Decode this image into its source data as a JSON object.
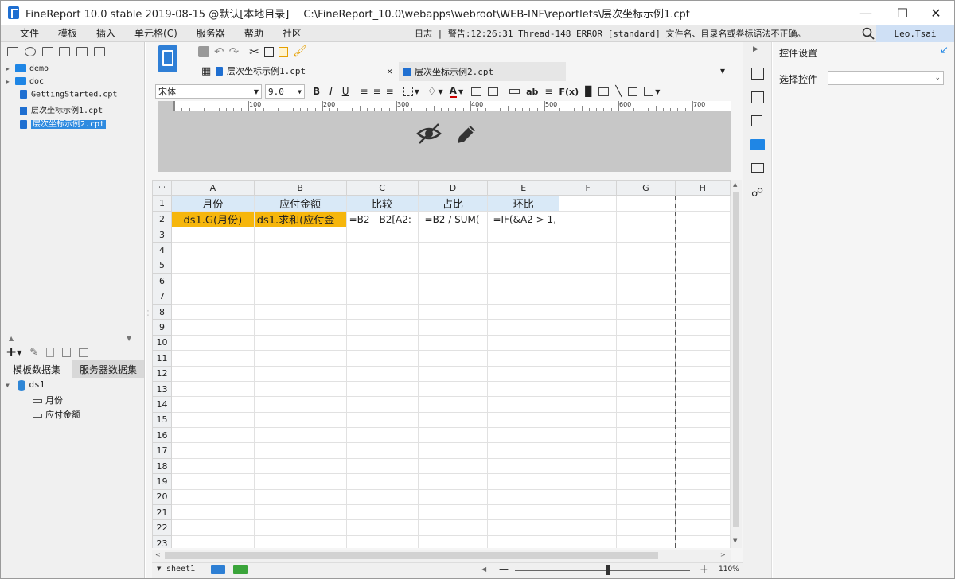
{
  "window": {
    "title": "FineReport 10.0 stable 2019-08-15 @默认[本地目录]",
    "path": "C:\\FineReport_10.0\\webapps\\webroot\\WEB-INF\\reportlets\\层次坐标示例1.cpt"
  },
  "menu": [
    "文件",
    "模板",
    "插入",
    "单元格(C)",
    "服务器",
    "帮助",
    "社区"
  ],
  "log": {
    "label": "日志",
    "message": "| 警告:12:26:31 Thread-148 ERROR [standard] 文件名、目录名或卷标语法不正确。"
  },
  "user": "Leo.Tsai",
  "file_tree": {
    "items": [
      {
        "label": "demo",
        "type": "folder"
      },
      {
        "label": "doc",
        "type": "folder"
      },
      {
        "label": "GettingStarted.cpt",
        "type": "file"
      },
      {
        "label": "层次坐标示例1.cpt",
        "type": "file"
      },
      {
        "label": "层次坐标示例2.cpt",
        "type": "file",
        "selected": true
      }
    ]
  },
  "dataset_tabs": [
    "模板数据集",
    "服务器数据集"
  ],
  "dataset": {
    "name": "ds1",
    "fields": [
      "月份",
      "应付金额"
    ]
  },
  "editor_tabs": [
    {
      "label": "层次坐标示例1.cpt",
      "active": true
    },
    {
      "label": "层次坐标示例2.cpt",
      "active": false
    }
  ],
  "format_bar": {
    "font": "宋体",
    "size": "9.0"
  },
  "ruler_ticks": [
    "100",
    "200",
    "300",
    "400",
    "500",
    "600",
    "700"
  ],
  "sheet": {
    "columns": [
      "A",
      "B",
      "C",
      "D",
      "E",
      "F",
      "G",
      "H"
    ],
    "row_numbers": [
      "1",
      "2",
      "3",
      "4",
      "5",
      "6",
      "7",
      "8",
      "9",
      "10",
      "11",
      "12",
      "13",
      "14",
      "15",
      "16",
      "17",
      "18",
      "19",
      "20",
      "21",
      "22",
      "23"
    ],
    "header_row": [
      "月份",
      "应付金额",
      "比较",
      "占比",
      "环比"
    ],
    "data_row": [
      "ds1.G(月份)",
      "ds1.求和(应付金",
      "=B2 - B2[A2:",
      "=B2 / SUM(",
      "=IF(&A2 > 1,"
    ]
  },
  "sheet_tab": "sheet1",
  "zoom": "110%",
  "zoom_level_percent": 110,
  "right_panel": {
    "title": "控件设置",
    "select_label": "选择控件",
    "select_value": ""
  },
  "colors": {
    "accent": "#1f6fd1",
    "header_fill": "#d9e9f7",
    "highlight_fill": "#f6b60c",
    "selection": "#2f8be0"
  }
}
